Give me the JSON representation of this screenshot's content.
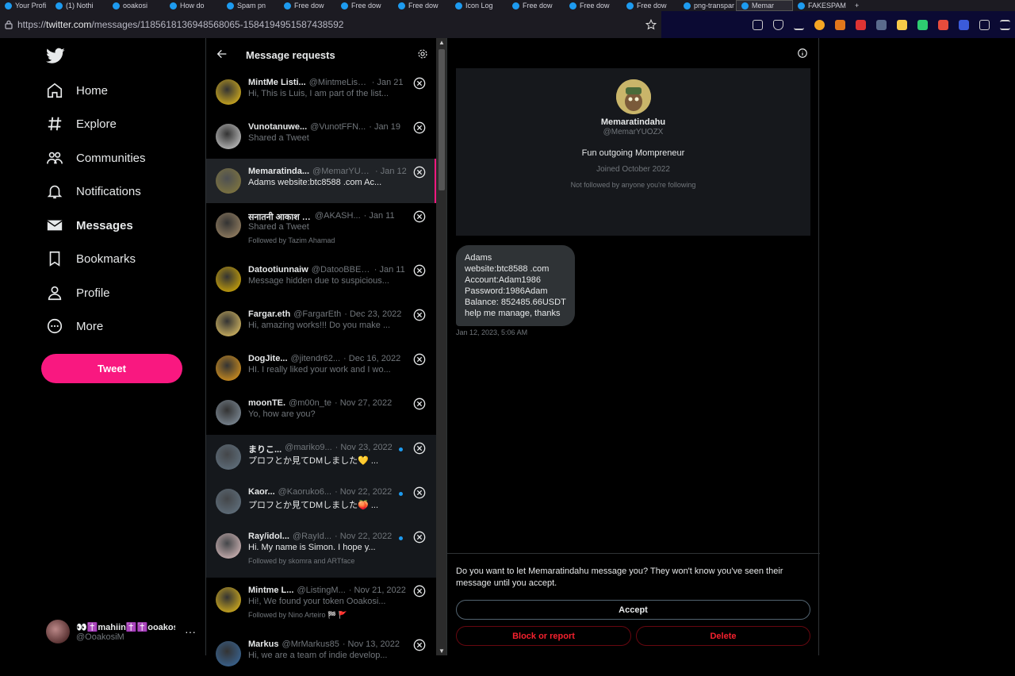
{
  "browser": {
    "tabs": [
      "Your Profi",
      "(1) Nothi",
      "ooakosi",
      "How do",
      "Spam pn",
      "Free dow",
      "Free dow",
      "Free dow",
      "Icon Log",
      "Free dow",
      "Free dow",
      "Free dow",
      "png-transpar",
      "Memar",
      "FAKESPAM"
    ],
    "new_tab": "+",
    "url_prefix": "https://",
    "url_host": "twitter.com",
    "url_path": "/messages/1185618136948568065-1584194951587438592"
  },
  "nav": {
    "items": [
      {
        "label": "Home",
        "icon": "home-icon"
      },
      {
        "label": "Explore",
        "icon": "hashtag-icon"
      },
      {
        "label": "Communities",
        "icon": "communities-icon"
      },
      {
        "label": "Notifications",
        "icon": "bell-icon"
      },
      {
        "label": "Messages",
        "icon": "envelope-icon"
      },
      {
        "label": "Bookmarks",
        "icon": "bookmark-icon"
      },
      {
        "label": "Profile",
        "icon": "person-icon"
      },
      {
        "label": "More",
        "icon": "more-circle-icon"
      }
    ],
    "tweet_label": "Tweet",
    "account_name": "👀✝️mahiin✝️✝️ooakos...",
    "account_handle": "@OoakosiM",
    "account_more": "···"
  },
  "requests": {
    "title": "Message requests",
    "rows": [
      {
        "name": "MintMe Listi...",
        "handle": "@MintmeListi...",
        "date": "· Jan 21",
        "preview": "Hi, This is Luis, I am part of the list...",
        "followed": "",
        "unread": false,
        "avatar": "#f0c419"
      },
      {
        "name": "Vunotanuwe...",
        "handle": "@VunotFFN...",
        "date": "· Jan 19",
        "preview": "Shared a Tweet",
        "followed": "",
        "unread": false,
        "avatar": "#d9d9d9"
      },
      {
        "name": "Memaratinda...",
        "handle": "@MemarYUO...",
        "date": "· Jan 12",
        "preview": "Adams website:btc8588 .com Ac...",
        "followed": "",
        "unread": false,
        "avatar": "#8a7d3a"
      },
      {
        "name": "सनातनी आकाश गु...",
        "handle": "@AKASH...",
        "date": "· Jan 11",
        "preview": "Shared a Tweet",
        "followed": "Followed by Tazim Ahamad",
        "unread": false,
        "avatar": "#a88f6b"
      },
      {
        "name": "Datootiunnaiw",
        "handle": "@DatooBBEJU",
        "date": "· Jan 11",
        "preview": "Message hidden due to suspicious...",
        "followed": "",
        "unread": false,
        "avatar": "#e6b800"
      },
      {
        "name": "Fargar.eth",
        "handle": "@FargarEth",
        "date": "· Dec 23, 2022",
        "preview": "Hi, amazing works!!! Do you make ...",
        "followed": "",
        "unread": false,
        "avatar": "#f2d06b"
      },
      {
        "name": "DogJite...",
        "handle": "@jitendr62...",
        "date": "· Dec 16, 2022",
        "preview": "HI. I really liked your work and I wo...",
        "followed": "",
        "unread": false,
        "avatar": "#f0a21a"
      },
      {
        "name": "moonTE.",
        "handle": "@m00n_te",
        "date": "· Nov 27, 2022",
        "preview": "Yo, how are you?",
        "followed": "",
        "unread": false,
        "avatar": "#8b9aa8"
      },
      {
        "name": "まりこ...",
        "handle": "@mariko9...",
        "date": "· Nov 23, 2022",
        "preview": "プロフとか見てDMしました💛 ...",
        "followed": "",
        "unread": true,
        "avatar": "#657786"
      },
      {
        "name": "Kaor...",
        "handle": "@Kaoruko6...",
        "date": "· Nov 22, 2022",
        "preview": "プロフとか見てDMしました🍑 ...",
        "followed": "",
        "unread": true,
        "avatar": "#657786"
      },
      {
        "name": "Ray/idol...",
        "handle": "@RayId...",
        "date": "· Nov 22, 2022",
        "preview": "Hi. My name is Simon. I hope y...",
        "followed": "Followed by skomra and ARTface",
        "unread": true,
        "avatar": "#e9c9c9"
      },
      {
        "name": "Mintme L...",
        "handle": "@ListingM...",
        "date": "· Nov 21, 2022",
        "preview": "Hi!, We found your token Ooakosi...",
        "followed": "Followed by Nino Arteiro 🏁 🚩",
        "unread": false,
        "avatar": "#f0c419"
      },
      {
        "name": "Markus",
        "handle": "@MrMarkus85",
        "date": "· Nov 13, 2022",
        "preview": "Hi, we are a team of indie develop...",
        "followed": "",
        "unread": false,
        "avatar": "#3a6ea5"
      }
    ]
  },
  "conversation": {
    "name": "Memaratindahu",
    "handle": "@MemarYUOZX",
    "bio": "Fun outgoing Mompreneur",
    "joined": "Joined October 2022",
    "followed": "Not followed by anyone you're following",
    "message": "Adams\nwebsite:btc8588 .com\nAccount:Adam1986\nPassword:1986Adam\nBalance: 852485.66USDT\nhelp me manage, thanks",
    "time": "Jan 12, 2023, 5:06 AM",
    "prompt": "Do you want to let Memaratindahu message you? They won't know you've seen their message until you accept.",
    "accept": "Accept",
    "block": "Block or report",
    "delete": "Delete"
  },
  "colors": {
    "accent": "#f91880",
    "danger": "#f4212e",
    "link": "#1d9bf0"
  }
}
